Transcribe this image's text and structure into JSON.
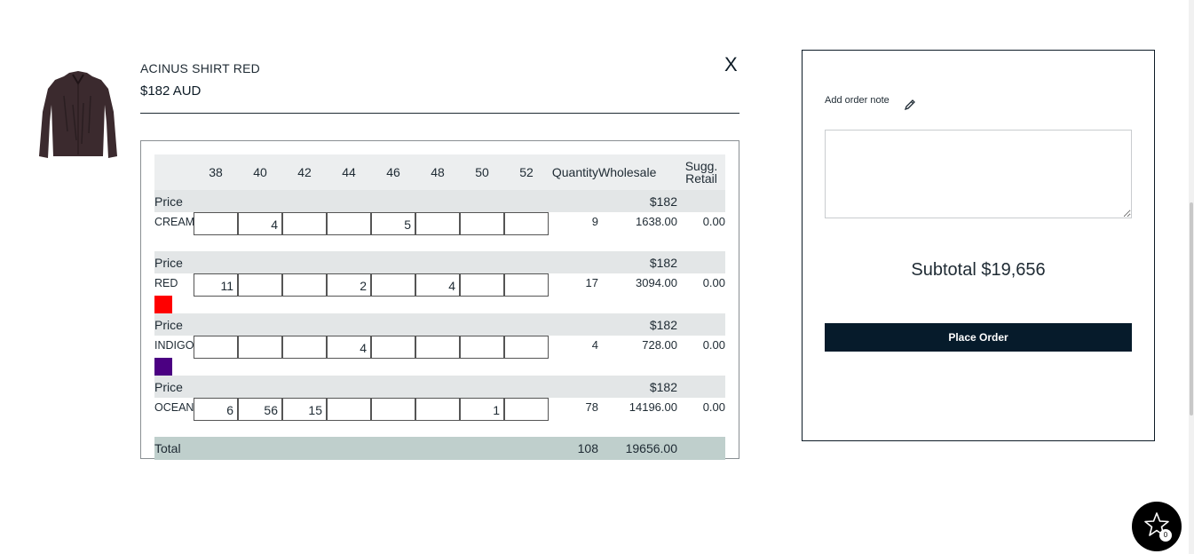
{
  "product": {
    "name": "ACINUS SHIRT RED",
    "price": "$182 AUD",
    "close_label": "X"
  },
  "grid": {
    "sizes": [
      "38",
      "40",
      "42",
      "44",
      "46",
      "48",
      "50",
      "52"
    ],
    "headers": {
      "quantity": "Quantity",
      "wholesale": "Wholesale",
      "retail_line1": "Sugg.",
      "retail_line2": "Retail"
    },
    "price_label": "Price",
    "rows": [
      {
        "color": "CREAM",
        "price": "$182",
        "swatch": null,
        "qty": [
          "",
          "4",
          "",
          "",
          "5",
          "",
          "",
          ""
        ],
        "quantity": "9",
        "wholesale": "1638.00",
        "retail": "0.00"
      },
      {
        "color": "RED",
        "price": "$182",
        "swatch": "#ff0000",
        "qty": [
          "11",
          "",
          "",
          "2",
          "",
          "4",
          "",
          ""
        ],
        "quantity": "17",
        "wholesale": "3094.00",
        "retail": "0.00"
      },
      {
        "color": "INDIGO",
        "price": "$182",
        "swatch": "#4b0082",
        "qty": [
          "",
          "",
          "",
          "4",
          "",
          "",
          "",
          ""
        ],
        "quantity": "4",
        "wholesale": "728.00",
        "retail": "0.00"
      },
      {
        "color": "OCEAN",
        "price": "$182",
        "swatch": null,
        "qty": [
          "6",
          "56",
          "15",
          "",
          "",
          "",
          "1",
          ""
        ],
        "quantity": "78",
        "wholesale": "14196.00",
        "retail": "0.00"
      }
    ],
    "total": {
      "label": "Total",
      "quantity": "108",
      "wholesale": "19656.00"
    }
  },
  "order_panel": {
    "note_label": "Add order note",
    "note_value": "",
    "subtotal": "Subtotal $19,656",
    "place_order_label": "Place Order"
  },
  "fab": {
    "icon": "star-icon",
    "count": "0"
  },
  "colors": {
    "accent": "#061b2b",
    "total_row": "#bfcfcc",
    "price_row": "#e3e6e7",
    "header_row": "#eceeef"
  }
}
